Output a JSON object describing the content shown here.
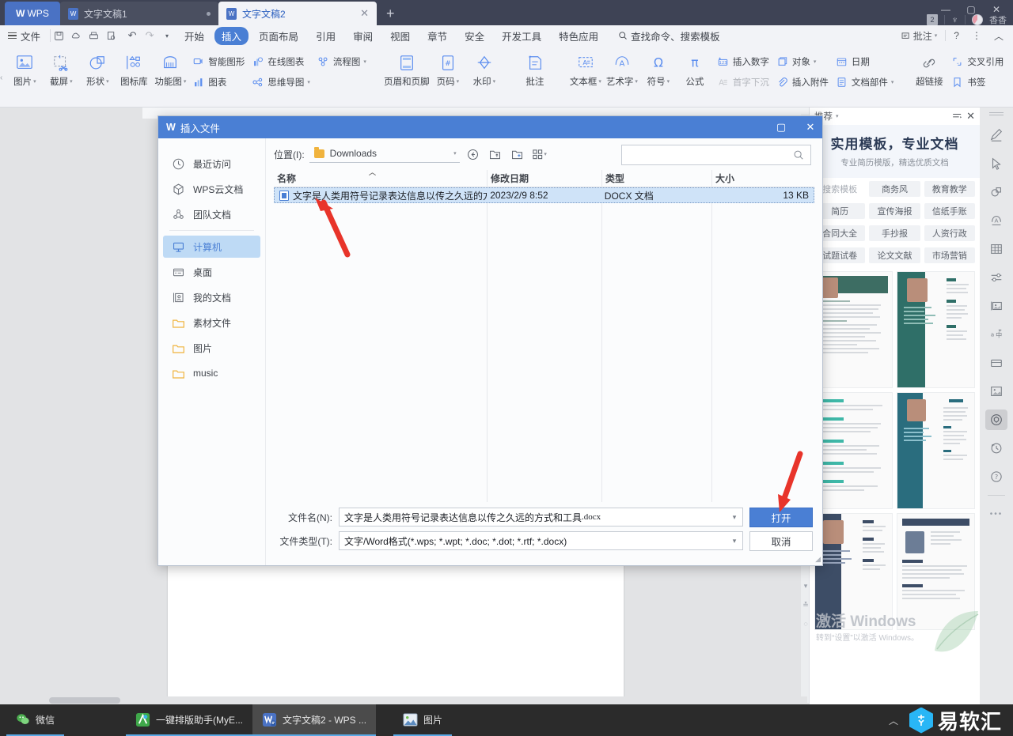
{
  "titlebar": {
    "app_name": "WPS",
    "tabs": [
      {
        "label": "文字文稿1",
        "state": "inactive"
      },
      {
        "label": "文字文稿2",
        "state": "active"
      }
    ],
    "new_tab": "+",
    "notification_count": "2",
    "user_name": "香香",
    "win_minimize": "—",
    "win_maximize": "▢",
    "win_close": "✕"
  },
  "menubar": {
    "file_label": "文件",
    "quick_access": [
      "save-icon",
      "cloud-sync-icon",
      "print-icon",
      "print-preview-icon",
      "undo-icon",
      "redo-icon",
      "customize-icon"
    ],
    "tabs": [
      {
        "label": "开始",
        "selected": false
      },
      {
        "label": "插入",
        "selected": true
      },
      {
        "label": "页面布局",
        "selected": false
      },
      {
        "label": "引用",
        "selected": false
      },
      {
        "label": "审阅",
        "selected": false
      },
      {
        "label": "视图",
        "selected": false
      },
      {
        "label": "章节",
        "selected": false
      },
      {
        "label": "安全",
        "selected": false
      },
      {
        "label": "开发工具",
        "selected": false
      },
      {
        "label": "特色应用",
        "selected": false
      }
    ],
    "search_placeholder": "查找命令、搜索模板",
    "right": {
      "comment_label": "批注",
      "help_label": "?",
      "more_label": "⋮",
      "collapse_label": "︿"
    }
  },
  "ribbon": {
    "groups": [
      {
        "big": [
          {
            "label": "图片",
            "icon": "picture-icon",
            "caret": true
          },
          {
            "label": "截屏",
            "icon": "screenshot-icon",
            "caret": true
          },
          {
            "label": "形状",
            "icon": "shape-icon",
            "caret": true
          },
          {
            "label": "图标库",
            "icon": "icon-library-icon",
            "caret": false
          },
          {
            "label": "功能图",
            "icon": "function-chart-icon",
            "caret": true
          }
        ],
        "small": [
          {
            "label": "智能图形",
            "icon": "smart-graphic-icon",
            "caret": false,
            "dim": false
          },
          {
            "label": "图表",
            "icon": "chart-icon",
            "caret": false,
            "dim": false
          }
        ],
        "small2": [
          {
            "label": "在线图表",
            "icon": "online-chart-icon",
            "caret": false,
            "dim": false
          },
          {
            "label": "思维导图",
            "icon": "mindmap-icon",
            "caret": true,
            "dim": false
          }
        ],
        "small3": [
          {
            "label": "流程图",
            "icon": "flowchart-icon",
            "caret": true,
            "dim": false
          }
        ]
      },
      {
        "big": [
          {
            "label": "页眉和页脚",
            "icon": "header-footer-icon",
            "caret": false
          },
          {
            "label": "页码",
            "icon": "page-number-icon",
            "caret": true
          },
          {
            "label": "水印",
            "icon": "watermark-icon",
            "caret": true
          }
        ]
      },
      {
        "big": [
          {
            "label": "批注",
            "icon": "comment-icon",
            "caret": false
          }
        ]
      },
      {
        "big": [
          {
            "label": "文本框",
            "icon": "textbox-icon",
            "caret": true
          },
          {
            "label": "艺术字",
            "icon": "wordart-icon",
            "caret": true
          },
          {
            "label": "符号",
            "icon": "symbol-icon",
            "caret": true
          },
          {
            "label": "公式",
            "icon": "formula-icon",
            "caret": false
          }
        ],
        "small": [
          {
            "label": "插入数字",
            "icon": "insert-number-icon",
            "caret": false,
            "dim": false
          },
          {
            "label": "首字下沉",
            "icon": "drop-cap-icon",
            "caret": false,
            "dim": true
          }
        ],
        "small2": [
          {
            "label": "对象",
            "icon": "object-icon",
            "caret": true,
            "dim": false
          },
          {
            "label": "插入附件",
            "icon": "attachment-icon",
            "caret": false,
            "dim": false
          }
        ],
        "small3": [
          {
            "label": "日期",
            "icon": "date-icon",
            "caret": false,
            "dim": false
          },
          {
            "label": "文档部件",
            "icon": "document-parts-icon",
            "caret": true,
            "dim": false
          }
        ]
      },
      {
        "big": [
          {
            "label": "超链接",
            "icon": "hyperlink-icon",
            "caret": false
          }
        ],
        "small": [
          {
            "label": "交叉引用",
            "icon": "cross-reference-icon",
            "caret": false,
            "dim": false
          },
          {
            "label": "书签",
            "icon": "bookmark-icon",
            "caret": false,
            "dim": false
          }
        ]
      }
    ],
    "icon_pad": [
      {
        "name": "text-field-icon",
        "state": "normal"
      },
      {
        "name": "checkbox-field-icon",
        "state": "normal"
      },
      {
        "name": "combo-field-icon",
        "state": "normal"
      },
      {
        "name": "protect-field-icon",
        "state": "dim"
      },
      {
        "name": "form-frame-icon",
        "state": "on"
      },
      {
        "name": "refresh-field-icon",
        "state": "normal"
      },
      {
        "name": "lock-form-icon",
        "state": "normal"
      }
    ]
  },
  "dialog": {
    "title": "插入文件",
    "maximize_label": "▢",
    "close_label": "✕",
    "places": [
      {
        "label": "最近访问",
        "icon": "clock-icon",
        "selected": false
      },
      {
        "label": "WPS云文档",
        "icon": "cloud-cube-icon",
        "selected": false
      },
      {
        "label": "团队文档",
        "icon": "team-icon",
        "selected": false
      },
      {
        "label": "计算机",
        "icon": "computer-icon",
        "selected": true
      },
      {
        "label": "桌面",
        "icon": "desktop-icon",
        "selected": false
      },
      {
        "label": "我的文档",
        "icon": "my-documents-icon",
        "selected": false
      },
      {
        "label": "素材文件",
        "icon": "folder-icon",
        "selected": false
      },
      {
        "label": "图片",
        "icon": "folder-icon",
        "selected": false
      },
      {
        "label": "music",
        "icon": "folder-icon",
        "selected": false
      }
    ],
    "path_label": "位置(I):",
    "path_value": "Downloads",
    "nav": {
      "back": "back-icon",
      "up": "up-folder-icon",
      "new_folder": "new-folder-icon",
      "view": "view-mode-icon"
    },
    "search_placeholder": "",
    "columns": [
      "名称",
      "修改日期",
      "类型",
      "大小"
    ],
    "rows": [
      {
        "name": "文字是人类用符号记录表达信息以传之久远的方式...",
        "modified": "2023/2/9 8:52",
        "type": "DOCX 文档",
        "size": "13 KB",
        "selected": true
      }
    ],
    "filename_label": "文件名(N):",
    "filename_value": "文字是人类用符号记录表达信息以传之久远的方式和工具",
    "filename_ext": ".docx",
    "filetype_label": "文件类型(T):",
    "filetype_value": "文字/Word格式(*.wps; *.wpt; *.doc; *.dot; *.rtf; *.docx)",
    "open_button": "打开",
    "cancel_button": "取消"
  },
  "right_panel": {
    "header_label": "推荐",
    "header_menu_icon": "list-menu-icon",
    "header_close_icon": "close-icon",
    "hero_title": "实用模板，专业文档",
    "hero_subtitle": "专业简历模版，精选优质文档",
    "chips_row1": [
      "搜索模板",
      "商务风",
      "教育教学"
    ],
    "chips_row2": [
      "简历",
      "宣传海报",
      "信纸手账"
    ],
    "chips_row3": [
      "合同大全",
      "手抄报",
      "人资行政"
    ],
    "chips_row4": [
      "试题试卷",
      "论文文献",
      "市场营销"
    ],
    "watermark_title": "激活 Windows",
    "watermark_sub": "转到“设置”以激活 Windows。"
  },
  "rail": {
    "icons": [
      {
        "name": "pen-icon",
        "state": "normal"
      },
      {
        "name": "cursor-icon",
        "state": "normal"
      },
      {
        "name": "shapes-icon",
        "state": "normal"
      },
      {
        "name": "wordart-icon",
        "state": "normal"
      },
      {
        "name": "table-icon",
        "state": "normal"
      },
      {
        "name": "settings-slider-icon",
        "state": "normal"
      },
      {
        "name": "image-panel-icon",
        "state": "normal"
      },
      {
        "name": "translate-icon",
        "state": "normal"
      },
      {
        "name": "box-icon",
        "state": "normal"
      },
      {
        "name": "picture-frame-icon",
        "state": "normal"
      },
      {
        "name": "shield-icon",
        "state": "on"
      },
      {
        "name": "history-icon",
        "state": "normal"
      },
      {
        "name": "help-circle-icon",
        "state": "normal"
      },
      {
        "name": "more-dots-icon",
        "state": "normal"
      }
    ]
  },
  "taskbar": {
    "items": [
      {
        "label": "微信",
        "icon": "wechat-icon",
        "active": false,
        "underline": true
      },
      {
        "label": "一键排版助手(MyE...",
        "icon": "typeset-helper-icon",
        "active": false,
        "underline": true
      },
      {
        "label": "文字文稿2 - WPS ...",
        "icon": "wps-writer-icon",
        "active": true,
        "underline": true
      },
      {
        "label": "图片",
        "icon": "photos-icon",
        "active": false,
        "underline": true
      }
    ],
    "tray_chevron": "︿",
    "brand_text": "易软汇"
  },
  "colors": {
    "accent_blue": "#4a7fd4",
    "title_dark": "#3e4355",
    "ribbon_bg": "#f2f3f7",
    "select_blue": "#cfe3f8",
    "arrow_red": "#e8342a",
    "folder_yellow": "#f0b33d"
  }
}
